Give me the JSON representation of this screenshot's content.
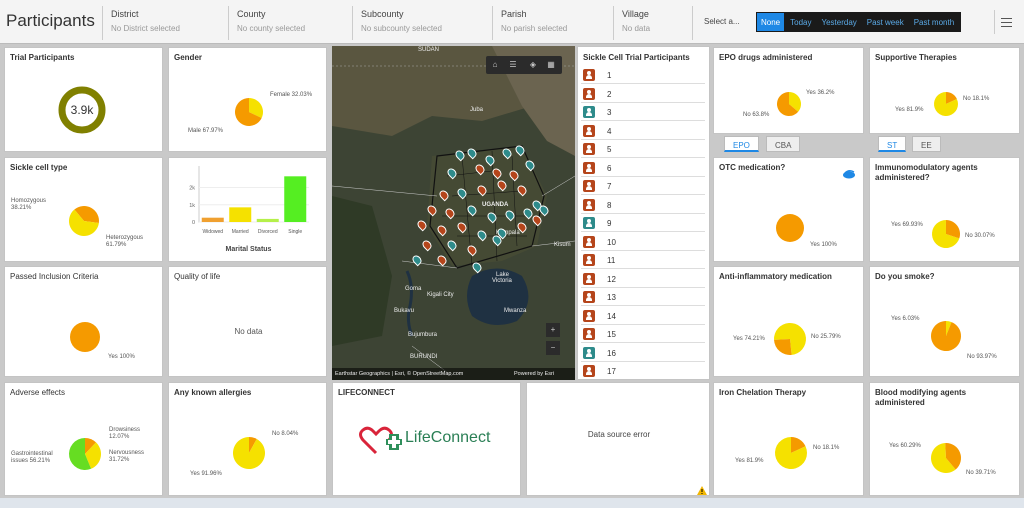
{
  "header": {
    "title": "Participants",
    "filters": [
      {
        "label": "District",
        "value": "No District selected"
      },
      {
        "label": "County",
        "value": "No county selected"
      },
      {
        "label": "Subcounty",
        "value": "No subcounty selected"
      },
      {
        "label": "Parish",
        "value": "No parish selected"
      },
      {
        "label": "Village",
        "value": "No data"
      }
    ],
    "select_label": "Select a...",
    "time_buttons": [
      "None",
      "Today",
      "Yesterday",
      "Past week",
      "Past month"
    ],
    "active_button": "None",
    "menu_icon": "hamburger-menu-icon"
  },
  "cards": {
    "trial": {
      "title": "Trial Participants",
      "value": "3.9k",
      "ring_color": "#808000"
    },
    "gender": {
      "title": "Gender",
      "female": "Female 32.03%",
      "male": "Male 67.97%",
      "female_pct": 32.03,
      "male_pct": 67.97
    },
    "sickle": {
      "title": "Sickle cell type",
      "homo_name": "Homozygous",
      "homo_val": "38.21%",
      "het_name": "Heterozygous",
      "het_val": "61.79%",
      "homo_pct": 38.21,
      "het_pct": 61.79
    },
    "marital": {
      "title": "Marital Status"
    },
    "inclusion": {
      "title": "Passed Inclusion Criteria",
      "yes": "Yes 100%"
    },
    "quality": {
      "title": "Quality of life",
      "nodata": "No data"
    },
    "adverse": {
      "title": "Adverse effects",
      "drow_name": "Drowsiness",
      "drow_val": "12.07%",
      "nerv_name": "Nervousness",
      "nerv_val": "31.72%",
      "gastro_name": "Gastrointestinal",
      "gastro_val": "issues 56.21%",
      "drow_pct": 12.07,
      "nerv_pct": 31.72,
      "gastro_pct": 56.21
    },
    "allergies": {
      "title": "Any known allergies",
      "no": "No 8.04%",
      "yes": "Yes 91.96%",
      "no_pct": 8.04,
      "yes_pct": 91.96
    },
    "lifeconnect": {
      "title": "LIFECONNECT",
      "logo_text": "LifeConnect",
      "logo_icon": "heart-plus-icon"
    },
    "datasource": {
      "message": "Data source error",
      "icon": "warning-icon"
    },
    "epo": {
      "title": "EPO drugs administered",
      "yes": "Yes 36.2%",
      "no": "No 63.8%",
      "yes_pct": 36.2,
      "no_pct": 63.8,
      "tabs": [
        "EPO",
        "CBA"
      ]
    },
    "supportive": {
      "title": "Supportive Therapies",
      "no": "No 18.1%",
      "yes": "Yes 81.9%",
      "no_pct": 18.1,
      "yes_pct": 81.9,
      "tabs": [
        "ST",
        "EE"
      ]
    },
    "otc": {
      "title": "OTC medication?",
      "yes": "Yes 100%",
      "icon": "pill-icon"
    },
    "immuno": {
      "title": "Immunomodulatory agents administered?",
      "yes": "Yes 69.93%",
      "no": "No 30.07%",
      "yes_pct": 69.93,
      "no_pct": 30.07
    },
    "antiinfl": {
      "title": "Anti-inflammatory medication",
      "yes": "Yes 74.21%",
      "no": "No 25.79%",
      "yes_pct": 74.21,
      "no_pct": 25.79
    },
    "smoke": {
      "title": "Do you smoke?",
      "yes": "Yes 6.03%",
      "no": "No 93.97%",
      "yes_pct": 6.03,
      "no_pct": 93.97
    },
    "iron": {
      "title": "Iron Chelation Therapy",
      "no": "No 18.1%",
      "yes": "Yes 81.9%",
      "no_pct": 18.1,
      "yes_pct": 81.9
    },
    "blood": {
      "title": "Blood modifying agents administered",
      "yes": "Yes 60.29%",
      "no": "No 39.71%",
      "yes_pct": 60.29,
      "no_pct": 39.71
    }
  },
  "chart_data": {
    "type": "bar",
    "title": "Marital Status",
    "categories": [
      "Widowed",
      "Married",
      "Divorced",
      "Single"
    ],
    "values": [
      250,
      850,
      180,
      2650
    ],
    "colors": [
      "#f0a030",
      "#f5e100",
      "#b5f04a",
      "#55ee22"
    ],
    "yticks": [
      "0",
      "1k",
      "2k"
    ],
    "ylim": [
      0,
      2900
    ]
  },
  "map": {
    "labels": {
      "sudan": "SUDAN",
      "juba": "Juba",
      "uganda": "UGANDA",
      "kampala": "Kampala",
      "kisum": "Kisum",
      "lake1": "Lake",
      "lake2": "Victoria",
      "goma": "Goma",
      "kigali": "Kigali City",
      "bukavu": "Bukavu",
      "mwanza": "Mwanza",
      "bujumbura": "Bujumbura",
      "burundi": "BURUNDI"
    },
    "attribution": "Earthstar Geographics | Esri, © OpenStreetMap.com",
    "powered": "Powered by Esri",
    "zoom_in": "+",
    "zoom_out": "−"
  },
  "participants_list": {
    "title": "Sickle Cell Trial Participants",
    "rows": [
      "1",
      "2",
      "3",
      "4",
      "5",
      "6",
      "7",
      "8",
      "9",
      "10",
      "11",
      "12",
      "13",
      "14",
      "15",
      "16",
      "17"
    ],
    "colors": [
      "#b5451b",
      "#b5451b",
      "#2e8b8b",
      "#b5451b",
      "#b5451b",
      "#b5451b",
      "#b5451b",
      "#b5451b",
      "#2e8b8b",
      "#b5451b",
      "#b5451b",
      "#b5451b",
      "#b5451b",
      "#b5451b",
      "#b5451b",
      "#2e8b8b",
      "#b5451b"
    ]
  }
}
